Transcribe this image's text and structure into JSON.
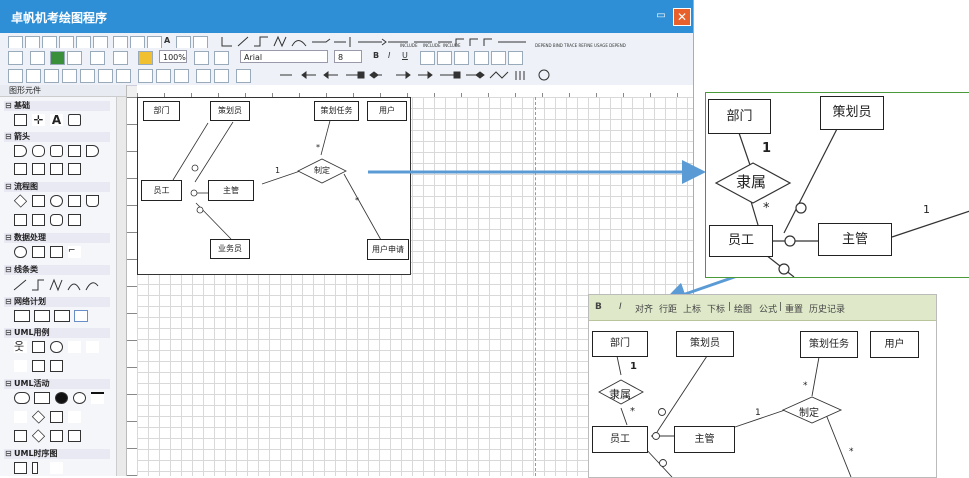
{
  "window": {
    "title": "卓帆机考绘图程序",
    "min_symbol": "▭",
    "close_symbol": "✕"
  },
  "toolbar": {
    "zoom": "100%",
    "font": "Arial",
    "font_size": "8",
    "bold": "B",
    "italic": "I",
    "underline": "U",
    "arrow_labels": [
      "INCLUDE",
      "INCLUDE",
      "INCLUDE",
      "INCLUDE"
    ],
    "dep_labels": "DEPEND BIND TRACE REFINE USAGE DEPEND"
  },
  "sidebar": {
    "title": "图形元件",
    "sections": [
      "基础",
      "箭头",
      "流程图",
      "数据处理",
      "线条类",
      "网络计划",
      "UML用例",
      "UML活动",
      "UML时序图"
    ],
    "text_tool": "A"
  },
  "diagram": {
    "entities": {
      "dept": "部门",
      "planner": "策划员",
      "plan_task": "策划任务",
      "user": "用户",
      "employee": "员工",
      "manager": "主管",
      "salesman": "业务员",
      "user_request": "用户申请"
    },
    "relations": {
      "formulate": "制定",
      "belong": "隶属"
    },
    "card": {
      "one": "1",
      "many": "*"
    }
  },
  "zoom2_toolbar": {
    "items": [
      "B",
      "I",
      "对齐",
      "行距",
      "上标",
      "下标",
      "绘图",
      "公式",
      "重置",
      "历史记录"
    ],
    "sep": "|"
  },
  "colors": {
    "title_bar": "#2e8fd6",
    "arrow": "#5b9bd5",
    "zoom_border": "#4b9a3a"
  }
}
